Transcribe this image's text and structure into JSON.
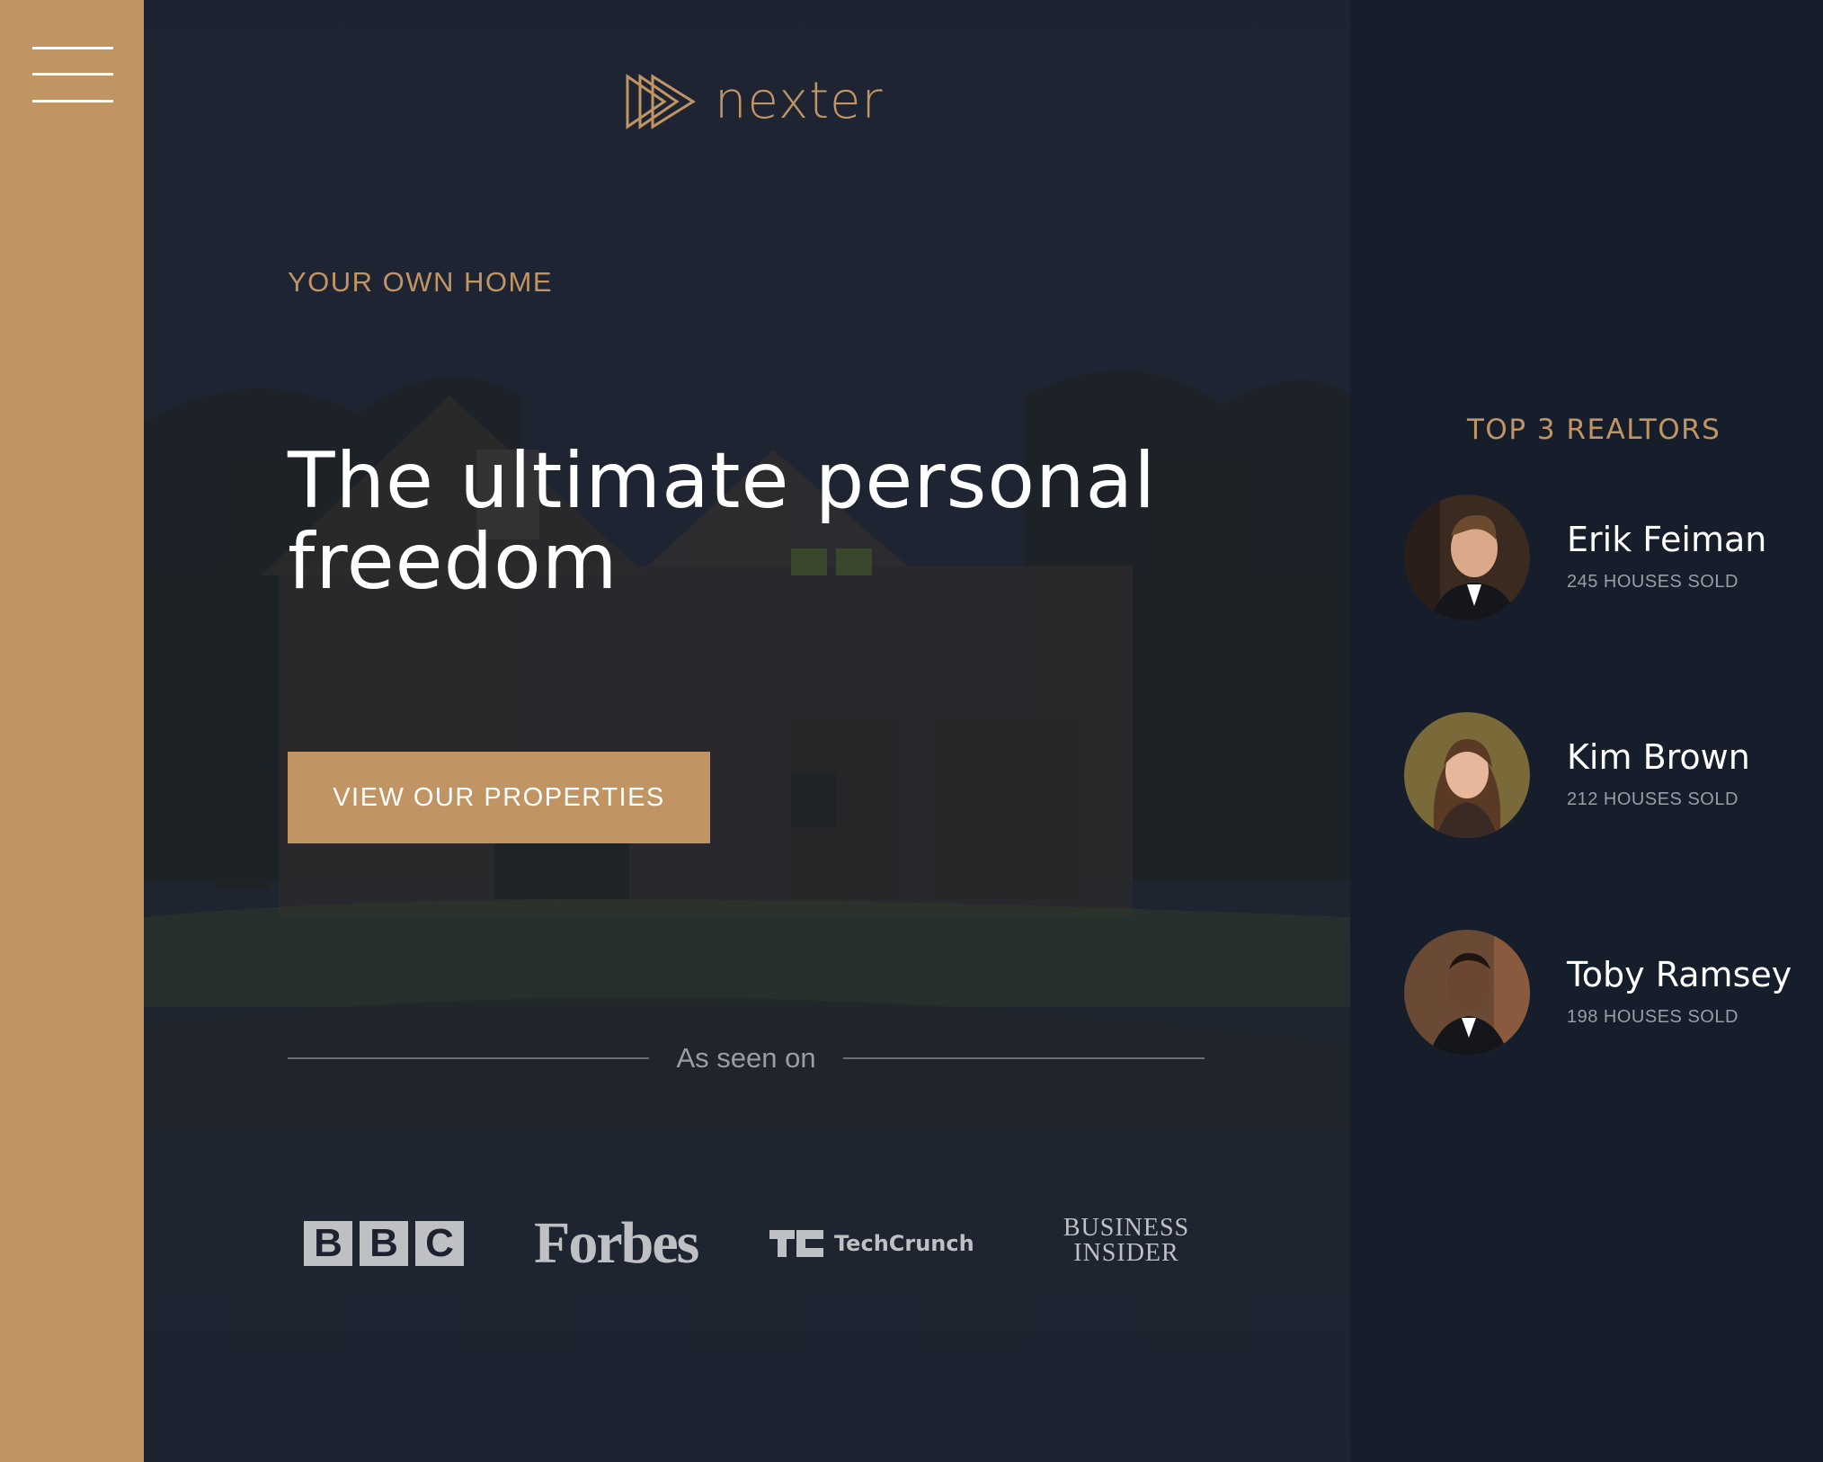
{
  "header": {
    "brand_name": "nexter",
    "menu_icon": "hamburger-menu-icon",
    "logo_icon": "triple-play-triangles-icon"
  },
  "hero": {
    "subtitle": "YOUR OWN HOME",
    "heading_line1": "The ultimate personal",
    "heading_line2": "freedom",
    "cta_label": "VIEW OUR PROPERTIES",
    "seen_on_label": "As seen on"
  },
  "press_logos": {
    "bbc": [
      "B",
      "B",
      "C"
    ],
    "forbes": "Forbes",
    "techcrunch": "TechCrunch",
    "business_insider_line1": "BUSINESS",
    "business_insider_line2": "INSIDER"
  },
  "realtors": {
    "title": "TOP 3 REALTORS",
    "items": [
      {
        "name": "Erik Feiman",
        "sold": "245 HOUSES SOLD"
      },
      {
        "name": "Kim Brown",
        "sold": "212 HOUSES SOLD"
      },
      {
        "name": "Toby Ramsey",
        "sold": "198 HOUSES SOLD"
      }
    ]
  },
  "colors": {
    "accent": "#c19563",
    "dark_background": "#161d2b",
    "hero_overlay": "#1b2130",
    "text_white": "#ffffff",
    "muted_gray": "#9a9da6"
  }
}
